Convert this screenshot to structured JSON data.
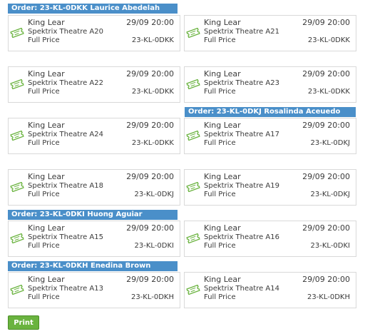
{
  "orders": [
    {
      "header": "Order: 23-KL-0DKK Laurice Abedelah",
      "tickets": [
        {
          "event": "King Lear",
          "datetime": "29/09 20:00",
          "venue_seat": "Spektrix Theatre A20",
          "price_type": "Full Price",
          "order_ref": "23-KL-0DKK"
        },
        {
          "event": "King Lear",
          "datetime": "29/09 20:00",
          "venue_seat": "Spektrix Theatre A21",
          "price_type": "Full Price",
          "order_ref": "23-KL-0DKK"
        },
        {
          "event": "King Lear",
          "datetime": "29/09 20:00",
          "venue_seat": "Spektrix Theatre A22",
          "price_type": "Full Price",
          "order_ref": "23-KL-0DKK"
        },
        {
          "event": "King Lear",
          "datetime": "29/09 20:00",
          "venue_seat": "Spektrix Theatre A23",
          "price_type": "Full Price",
          "order_ref": "23-KL-0DKK"
        },
        {
          "event": "King Lear",
          "datetime": "29/09 20:00",
          "venue_seat": "Spektrix Theatre A24",
          "price_type": "Full Price",
          "order_ref": "23-KL-0DKK"
        }
      ]
    },
    {
      "header": "Order: 23-KL-0DKJ Rosalinda Aceuedo",
      "tickets": [
        {
          "event": "King Lear",
          "datetime": "29/09 20:00",
          "venue_seat": "Spektrix Theatre A17",
          "price_type": "Full Price",
          "order_ref": "23-KL-0DKJ"
        },
        {
          "event": "King Lear",
          "datetime": "29/09 20:00",
          "venue_seat": "Spektrix Theatre A18",
          "price_type": "Full Price",
          "order_ref": "23-KL-0DKJ"
        },
        {
          "event": "King Lear",
          "datetime": "29/09 20:00",
          "venue_seat": "Spektrix Theatre A19",
          "price_type": "Full Price",
          "order_ref": "23-KL-0DKJ"
        }
      ]
    },
    {
      "header": "Order: 23-KL-0DKI Huong Aguiar",
      "tickets": [
        {
          "event": "King Lear",
          "datetime": "29/09 20:00",
          "venue_seat": "Spektrix Theatre A15",
          "price_type": "Full Price",
          "order_ref": "23-KL-0DKI"
        },
        {
          "event": "King Lear",
          "datetime": "29/09 20:00",
          "venue_seat": "Spektrix Theatre A16",
          "price_type": "Full Price",
          "order_ref": "23-KL-0DKI"
        }
      ]
    },
    {
      "header": "Order: 23-KL-0DKH Enedina Brown",
      "tickets": [
        {
          "event": "King Lear",
          "datetime": "29/09 20:00",
          "venue_seat": "Spektrix Theatre A13",
          "price_type": "Full Price",
          "order_ref": "23-KL-0DKH"
        },
        {
          "event": "King Lear",
          "datetime": "29/09 20:00",
          "venue_seat": "Spektrix Theatre A14",
          "price_type": "Full Price",
          "order_ref": "23-KL-0DKH"
        }
      ]
    }
  ],
  "print_button": {
    "label": "Print"
  },
  "icon": {
    "name": "ticket-icon",
    "color": "#6ab33f"
  },
  "colors": {
    "header_bg": "#4a8fc9",
    "header_text": "#ffffff",
    "button_bg": "#6ab33f"
  }
}
